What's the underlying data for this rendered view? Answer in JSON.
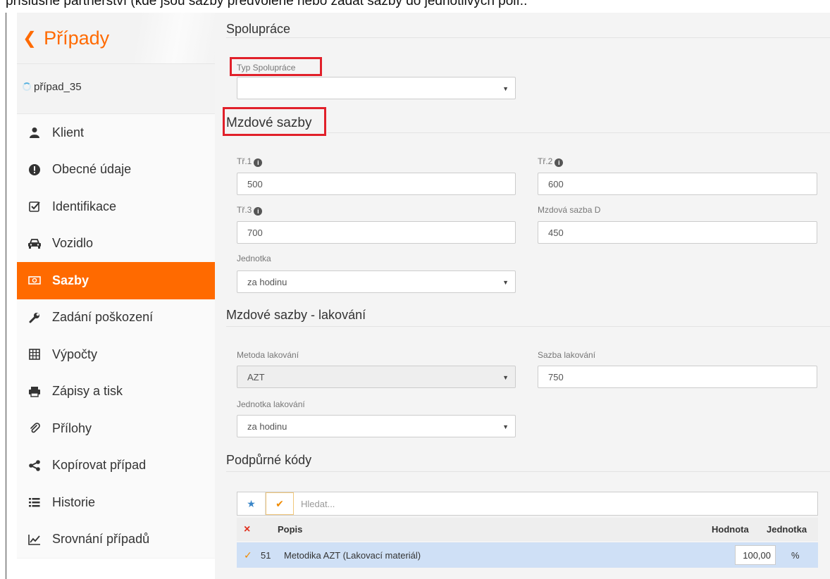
{
  "top_text": "příslušné partnerství (kde jsou sazby předvolené nebo zadat sazby do jednotlivých polí..",
  "sidebar": {
    "back_label": "Případy",
    "case_name": "případ_35",
    "items": [
      {
        "label": "Klient",
        "icon": "user-icon"
      },
      {
        "label": "Obecné údaje",
        "icon": "exclamation-circle-icon"
      },
      {
        "label": "Identifikace",
        "icon": "check-square-icon"
      },
      {
        "label": "Vozidlo",
        "icon": "car-icon"
      },
      {
        "label": "Sazby",
        "icon": "money-icon",
        "active": true
      },
      {
        "label": "Zadání poškození",
        "icon": "wrench-icon"
      },
      {
        "label": "Výpočty",
        "icon": "calculator-icon"
      },
      {
        "label": "Zápisy a tisk",
        "icon": "print-icon"
      },
      {
        "label": "Přílohy",
        "icon": "paperclip-icon"
      },
      {
        "label": "Kopírovat případ",
        "icon": "share-icon"
      },
      {
        "label": "Historie",
        "icon": "list-icon"
      },
      {
        "label": "Srovnání případů",
        "icon": "line-chart-icon"
      }
    ]
  },
  "cooperation": {
    "title": "Spolupráce",
    "type_label": "Typ Spolupráce",
    "type_value": ""
  },
  "wage_rates": {
    "title": "Mzdové sazby",
    "tr1_label": "Tř.1",
    "tr1_value": "500",
    "tr2_label": "Tř.2",
    "tr2_value": "600",
    "tr3_label": "Tř.3",
    "tr3_value": "700",
    "d_label": "Mzdová sazba D",
    "d_value": "450",
    "unit_label": "Jednotka",
    "unit_value": "za hodinu"
  },
  "paint_rates": {
    "title": "Mzdové sazby - lakování",
    "method_label": "Metoda lakování",
    "method_value": "AZT",
    "rate_label": "Sazba lakování",
    "rate_value": "750",
    "unit_label": "Jednotka lakování",
    "unit_value": "za hodinu"
  },
  "support_codes": {
    "title": "Podpůrné kódy",
    "search_placeholder": "Hledat...",
    "columns": {
      "remove": "×",
      "description": "Popis",
      "value": "Hodnota",
      "unit": "Jednotka"
    },
    "rows": [
      {
        "check": "✓",
        "code": "51",
        "description": "Metodika AZT (Lakovací materiál)",
        "value": "100,00",
        "unit": "%"
      }
    ]
  },
  "colors": {
    "accent": "#ff6a00",
    "highlight": "#e1202a",
    "selected_row": "#cfe0f6"
  }
}
